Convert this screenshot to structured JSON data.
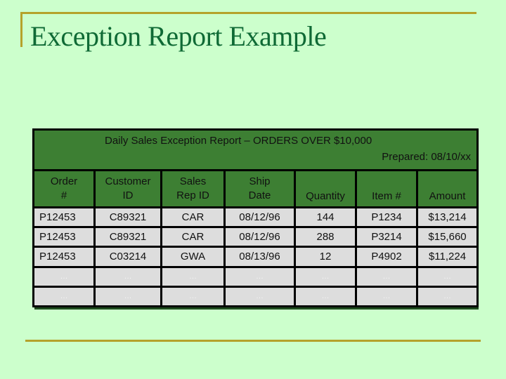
{
  "slide": {
    "title": "Exception Report Example"
  },
  "report": {
    "banner_title": "Daily Sales Exception Report – ORDERS OVER $10,000",
    "prepared": "Prepared: 08/10/xx",
    "columns": [
      {
        "line1": "Order",
        "line2": "#"
      },
      {
        "line1": "Customer",
        "line2": "ID"
      },
      {
        "line1": "Sales",
        "line2": "Rep ID"
      },
      {
        "line1": "Ship",
        "line2": "Date"
      },
      {
        "line1": "",
        "line2": "Quantity"
      },
      {
        "line1": "",
        "line2": "Item #"
      },
      {
        "line1": "",
        "line2": "Amount"
      }
    ],
    "rows": [
      [
        "P12453",
        "C89321",
        "CAR",
        "08/12/96",
        "144",
        "P1234",
        "$13,214"
      ],
      [
        "P12453",
        "C89321",
        "CAR",
        "08/12/96",
        "288",
        "P3214",
        "$15,660"
      ],
      [
        "P12453",
        "C03214",
        "GWA",
        "08/13/96",
        "12",
        "P4902",
        "$11,224"
      ],
      [
        "…",
        "…",
        "…",
        "…",
        "…",
        "…",
        "…"
      ],
      [
        "…",
        "…",
        "…",
        "…",
        "…",
        "…",
        "…"
      ]
    ]
  },
  "colors": {
    "background": "#ccffcc",
    "accent_rule": "#b5a22b",
    "title_text": "#0f6a35",
    "header_fill": "#3d7f33",
    "cell_fill": "#dddddd"
  }
}
